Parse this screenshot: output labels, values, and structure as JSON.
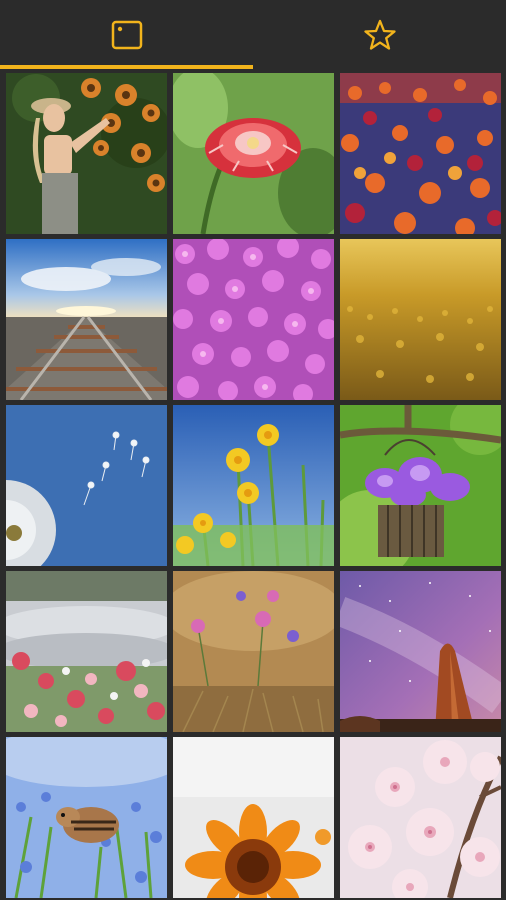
{
  "tabs": [
    {
      "id": "photos",
      "icon": "photo-frame-icon",
      "selected": true
    },
    {
      "id": "favorites",
      "icon": "star-icon",
      "selected": false
    }
  ],
  "colors": {
    "background": "#2b2b2b",
    "accent": "#f2b41c"
  },
  "photos": [
    {
      "subject": "woman-sunflowers"
    },
    {
      "subject": "red-dahlia"
    },
    {
      "subject": "tulip-field"
    },
    {
      "subject": "railway-tracks-sky"
    },
    {
      "subject": "pink-purple-flowers"
    },
    {
      "subject": "golden-field"
    },
    {
      "subject": "dandelion-seeds-sky"
    },
    {
      "subject": "yellow-daffodils"
    },
    {
      "subject": "hanging-basket-flowers"
    },
    {
      "subject": "pink-flowers-blur"
    },
    {
      "subject": "wildflowers-meadow"
    },
    {
      "subject": "milky-way-rocks"
    },
    {
      "subject": "chipmunk-bluebells"
    },
    {
      "subject": "sunflower-closeup"
    },
    {
      "subject": "cherry-blossoms"
    }
  ]
}
